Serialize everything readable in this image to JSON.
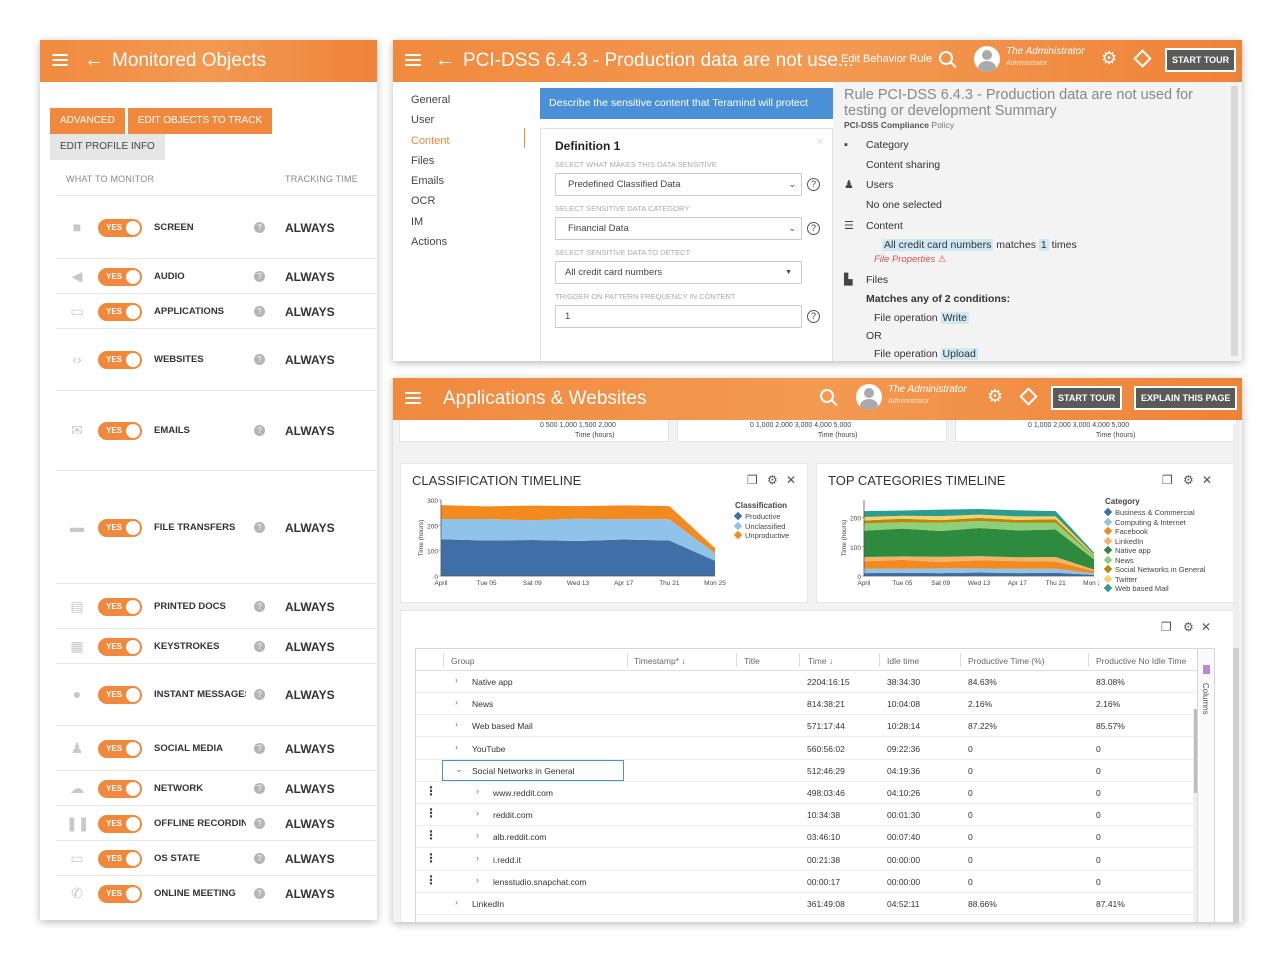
{
  "monitored": {
    "title": "Monitored Objects",
    "buttons": [
      "Advanced",
      "Edit objects to track",
      "Edit profile info"
    ],
    "col_what": "What to monitor",
    "col_time": "Tracking time",
    "toggle_label": "YES",
    "rows": [
      {
        "label": "Screen",
        "icon": "video-camera-icon",
        "value": "Always"
      },
      {
        "label": "Audio",
        "icon": "speaker-icon",
        "value": "Always"
      },
      {
        "label": "Applications",
        "icon": "app-window-icon",
        "value": "Always"
      },
      {
        "label": "Websites",
        "icon": "code-icon",
        "value": "Always"
      },
      {
        "label": "Emails",
        "icon": "envelope-icon",
        "value": "Always"
      },
      {
        "label": "File transfers",
        "icon": "drive-icon",
        "value": "Always"
      },
      {
        "label": "Printed docs",
        "icon": "printer-icon",
        "value": "Always"
      },
      {
        "label": "Keystrokes",
        "icon": "keyboard-icon",
        "value": "Always"
      },
      {
        "label": "Instant messages",
        "icon": "chat-bubble-icon",
        "value": "Always"
      },
      {
        "label": "Social media",
        "icon": "users-icon",
        "value": "Always"
      },
      {
        "label": "Network",
        "icon": "cloud-icon",
        "value": "Always"
      },
      {
        "label": "Offline recording",
        "icon": "pause-icon",
        "value": "Always"
      },
      {
        "label": "OS state",
        "icon": "monitor-icon",
        "value": "Always"
      },
      {
        "label": "Online meeting",
        "icon": "phone-icon",
        "value": "Always"
      }
    ]
  },
  "rule": {
    "title": "PCI-DSS 6.4.3 - Production data are not use...",
    "edit_link": "Edit Behavior Rule",
    "user_name": "The Administrator",
    "user_role": "Administrator",
    "start_tour": "Start tour",
    "nav": [
      "General",
      "User",
      "Content",
      "Files",
      "Emails",
      "OCR",
      "IM",
      "Actions"
    ],
    "banner": "Describe the sensitive content that Teramind will protect",
    "definition_title": "Definition 1",
    "fields": [
      {
        "label": "Select what makes this data sensitive",
        "value": "Predefined Classified Data"
      },
      {
        "label": "Select sensitive data category",
        "value": "Financial Data"
      },
      {
        "label": "Select sensitive data to detect",
        "value": "All credit card numbers"
      },
      {
        "label": "Trigger on pattern frequency in content",
        "value": "1"
      }
    ],
    "summary_title": "Rule PCI-DSS 6.4.3 - Production data are not used for testing or development Summary",
    "policy_name": "PCI-DSS Compliance",
    "policy_word": "Policy",
    "category_label": "Category",
    "category_value": "Content sharing",
    "users_label": "Users",
    "users_value": "No one selected",
    "content_label": "Content",
    "content_highlight": "All credit card numbers",
    "content_matches": "matches",
    "content_count": "1",
    "content_times": "times",
    "file_props": "File Properties",
    "files_label": "Files",
    "files_match": "Matches any of 2 conditions:",
    "cond1": "File operation",
    "cond1_value": "Write",
    "or": "OR",
    "cond2": "File operation",
    "cond2_value": "Upload"
  },
  "apps": {
    "title": "Applications & Websites",
    "user_name": "The Administrator",
    "user_role": "Administrator",
    "start_tour": "Start tour",
    "explain": "Explain this page",
    "top_ticks": [
      {
        "ticks": "0    500  1,000  1,500  2,000",
        "caption": "Time (hours)"
      },
      {
        "ticks": "0         1,000       2,000       3,000       4,000    5,000",
        "caption": "Time (hours)"
      },
      {
        "ticks": "0         1,000       2,000       3,000       4,000    5,000",
        "caption": "Time (hours)"
      }
    ],
    "table": {
      "columns": [
        "Group",
        "Timestamp*",
        "Title",
        "Time",
        "Idle time",
        "Productive Time (%)",
        "Productive No Idle Time"
      ],
      "columns_btn": "Columns",
      "rows": [
        {
          "group": "Native app",
          "time": "2204:16:15",
          "idle": "38:34:30",
          "prod": "84.63%",
          "prod_no_idle": "83.08%",
          "level": 0,
          "expanded": false
        },
        {
          "group": "News",
          "time": "814:38:21",
          "idle": "10:04:08",
          "prod": "2.16%",
          "prod_no_idle": "2.16%",
          "level": 0,
          "expanded": false
        },
        {
          "group": "Web based Mail",
          "time": "571:17:44",
          "idle": "10:28:14",
          "prod": "87.22%",
          "prod_no_idle": "85.57%",
          "level": 0,
          "expanded": false
        },
        {
          "group": "YouTube",
          "time": "560:56:02",
          "idle": "09:22:36",
          "prod": "0",
          "prod_no_idle": "0",
          "level": 0,
          "expanded": false
        },
        {
          "group": "Social Networks in General",
          "time": "512:46:29",
          "idle": "04:19:36",
          "prod": "0",
          "prod_no_idle": "0",
          "level": 0,
          "expanded": true
        },
        {
          "group": "www.reddit.com",
          "time": "498:03:46",
          "idle": "04:10:26",
          "prod": "0",
          "prod_no_idle": "0",
          "level": 1,
          "expanded": false
        },
        {
          "group": "reddit.com",
          "time": "10:34:38",
          "idle": "00:01:30",
          "prod": "0",
          "prod_no_idle": "0",
          "level": 1,
          "expanded": false
        },
        {
          "group": "alb.reddit.com",
          "time": "03:46:10",
          "idle": "00:07:40",
          "prod": "0",
          "prod_no_idle": "0",
          "level": 1,
          "expanded": false
        },
        {
          "group": "i.redd.it",
          "time": "00:21:38",
          "idle": "00:00:00",
          "prod": "0",
          "prod_no_idle": "0",
          "level": 1,
          "expanded": false
        },
        {
          "group": "lensstudio.snapchat.com",
          "time": "00:00:17",
          "idle": "00:00:00",
          "prod": "0",
          "prod_no_idle": "0",
          "level": 1,
          "expanded": false
        },
        {
          "group": "LinkedIn",
          "time": "361:49:08",
          "idle": "04:52:11",
          "prod": "88.66%",
          "prod_no_idle": "87.41%",
          "level": 0,
          "expanded": false
        }
      ]
    }
  },
  "chart_data": [
    {
      "type": "area",
      "title": "Classification Timeline",
      "xlabel": "",
      "ylabel": "Time (hours)",
      "ylim": [
        0,
        300
      ],
      "yticks": [
        0,
        100,
        200,
        300
      ],
      "x": [
        "April",
        "Tue 05",
        "Sat 09",
        "Wed 13",
        "Apr 17",
        "Thu 21",
        "Mon 25"
      ],
      "legend_title": "Classification",
      "legend_position": "right",
      "stacked": true,
      "series": [
        {
          "name": "Productive",
          "color": "#3f6fa6",
          "values": [
            145,
            140,
            142,
            138,
            144,
            140,
            60
          ]
        },
        {
          "name": "Unclassified",
          "color": "#8fc3ea",
          "values": [
            80,
            85,
            78,
            88,
            80,
            84,
            30
          ]
        },
        {
          "name": "Unproductive",
          "color": "#f38a1f",
          "values": [
            55,
            50,
            58,
            50,
            55,
            52,
            20
          ]
        }
      ]
    },
    {
      "type": "area",
      "title": "Top Categories Timeline",
      "xlabel": "",
      "ylabel": "Time (hours)",
      "ylim": [
        0,
        260
      ],
      "yticks": [
        0,
        100,
        200
      ],
      "x": [
        "April",
        "Tue 05",
        "Sat 09",
        "Wed 13",
        "Apr 17",
        "Thu 21",
        "Mon 25"
      ],
      "legend_title": "Category",
      "legend_position": "right",
      "stacked": true,
      "series": [
        {
          "name": "Business & Commercial",
          "color": "#3f6fa6",
          "values": [
            10,
            11,
            10,
            12,
            10,
            11,
            4
          ]
        },
        {
          "name": "Computing & Internet",
          "color": "#8fc3ea",
          "values": [
            15,
            14,
            16,
            14,
            15,
            14,
            5
          ]
        },
        {
          "name": "Facebook",
          "color": "#f38a1f",
          "values": [
            25,
            30,
            22,
            28,
            26,
            24,
            8
          ]
        },
        {
          "name": "LinkedIn",
          "color": "#f6b26b",
          "values": [
            15,
            12,
            18,
            14,
            13,
            16,
            5
          ]
        },
        {
          "name": "Native app",
          "color": "#2e8b3d",
          "values": [
            90,
            95,
            88,
            96,
            92,
            94,
            35
          ]
        },
        {
          "name": "News",
          "color": "#8ed07a",
          "values": [
            25,
            22,
            28,
            24,
            26,
            23,
            8
          ]
        },
        {
          "name": "Social Networks in General",
          "color": "#b8860b",
          "values": [
            10,
            12,
            9,
            11,
            10,
            12,
            4
          ]
        },
        {
          "name": "Twitter",
          "color": "#f5d36b",
          "values": [
            12,
            10,
            14,
            11,
            12,
            10,
            4
          ]
        },
        {
          "name": "Web based Mail",
          "color": "#2a9d8f",
          "values": [
            20,
            18,
            22,
            19,
            21,
            18,
            7
          ]
        }
      ]
    }
  ]
}
